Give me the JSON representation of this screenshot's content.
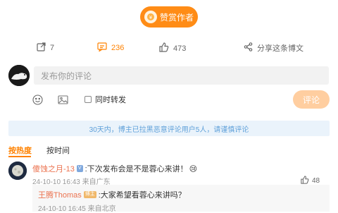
{
  "reward": {
    "label": "赞赏作者"
  },
  "stats": {
    "repost_count": "7",
    "comment_count": "236",
    "like_count": "473",
    "share_label": "分享这条博文"
  },
  "composer": {
    "placeholder": "发布你的评论",
    "checkbox_label": "同时转发",
    "submit_label": "评论"
  },
  "notice": "30天内，博主已拉黑恶意评论用户5人，请谨慎评论",
  "tabs": [
    {
      "label": "按热度"
    },
    {
      "label": "按时间"
    }
  ],
  "comments": [
    {
      "user": "傻蚀之月-13",
      "badge": "V",
      "text": ":下次发布会是不是蓉心来讲！",
      "emoji": "😢",
      "meta": "24-10-10 16:43 来自广东",
      "likes": "48",
      "reply": {
        "user": "王腾Thomas",
        "badge": "博主",
        "text": ":大家希望看蓉心来讲吗？",
        "meta": "24-10-10 16:45 来自北京"
      }
    }
  ],
  "colors": {
    "accent": "#ff8200",
    "reward": "#ff8c16",
    "submit_disabled": "#ffcea0",
    "notice_bg": "#eaf3fb",
    "notice_text": "#5fa0d9",
    "username": "#eb7350"
  }
}
